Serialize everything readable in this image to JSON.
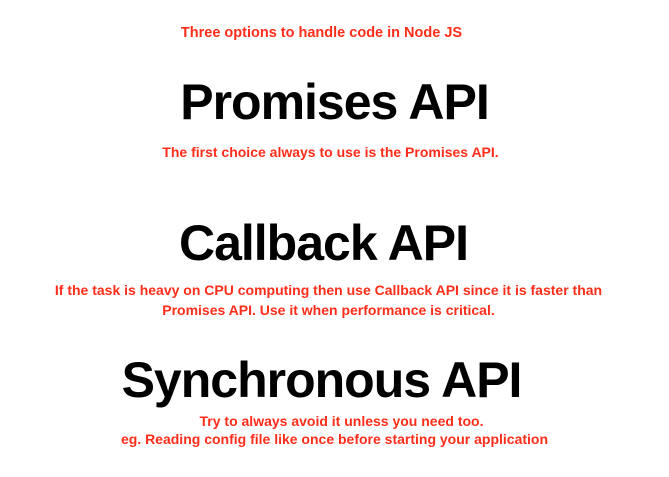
{
  "intro": "Three options to handle code in Node JS",
  "sections": [
    {
      "title": "Promises API",
      "notes": [
        "The first choice always to use is the Promises API."
      ]
    },
    {
      "title": "Callback API",
      "notes": [
        "If the task is heavy on CPU computing then use Callback API since it is faster than",
        "Promises API. Use it when performance is critical."
      ]
    },
    {
      "title": "Synchronous API",
      "notes": [
        "Try to always avoid it unless you need too.",
        "eg. Reading config file like once before starting your application"
      ]
    }
  ],
  "colors": {
    "accent": "#ff2d1a",
    "heading": "#000000",
    "background": "#ffffff"
  }
}
